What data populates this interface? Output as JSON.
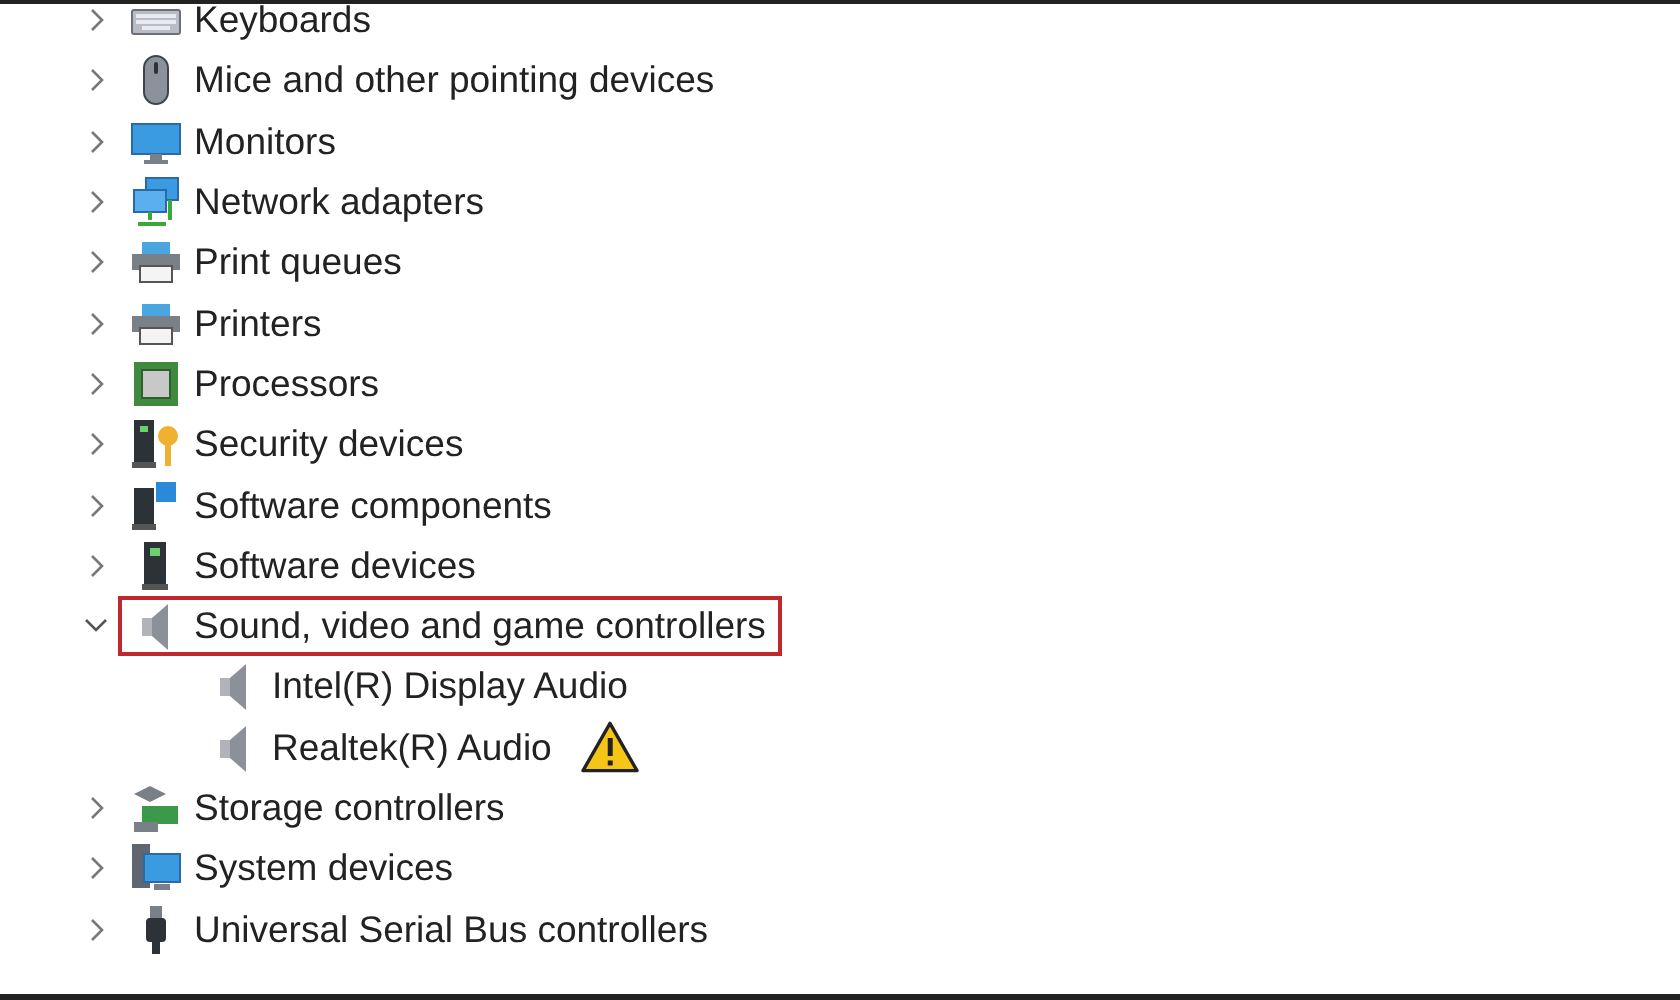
{
  "device_tree": {
    "items": [
      {
        "label": "Keyboards",
        "kind": "keyboard",
        "expanded": false,
        "highlighted": false
      },
      {
        "label": "Mice and other pointing devices",
        "kind": "mouse",
        "expanded": false,
        "highlighted": false
      },
      {
        "label": "Monitors",
        "kind": "monitor",
        "expanded": false,
        "highlighted": false
      },
      {
        "label": "Network adapters",
        "kind": "network",
        "expanded": false,
        "highlighted": false
      },
      {
        "label": "Print queues",
        "kind": "printer",
        "expanded": false,
        "highlighted": false
      },
      {
        "label": "Printers",
        "kind": "printer",
        "expanded": false,
        "highlighted": false
      },
      {
        "label": "Processors",
        "kind": "chip",
        "expanded": false,
        "highlighted": false
      },
      {
        "label": "Security devices",
        "kind": "security",
        "expanded": false,
        "highlighted": false
      },
      {
        "label": "Software components",
        "kind": "component",
        "expanded": false,
        "highlighted": false
      },
      {
        "label": "Software devices",
        "kind": "tower",
        "expanded": false,
        "highlighted": false
      },
      {
        "label": "Sound, video and game controllers",
        "kind": "speaker",
        "expanded": true,
        "highlighted": true,
        "children": [
          {
            "label": "Intel(R) Display Audio",
            "kind": "speaker",
            "warning": false
          },
          {
            "label": "Realtek(R) Audio",
            "kind": "speaker",
            "warning": true
          }
        ]
      },
      {
        "label": "Storage controllers",
        "kind": "storage",
        "expanded": false,
        "highlighted": false
      },
      {
        "label": "System devices",
        "kind": "system",
        "expanded": false,
        "highlighted": false
      },
      {
        "label": "Universal Serial Bus controllers",
        "kind": "usb",
        "expanded": false,
        "highlighted": false
      }
    ]
  }
}
